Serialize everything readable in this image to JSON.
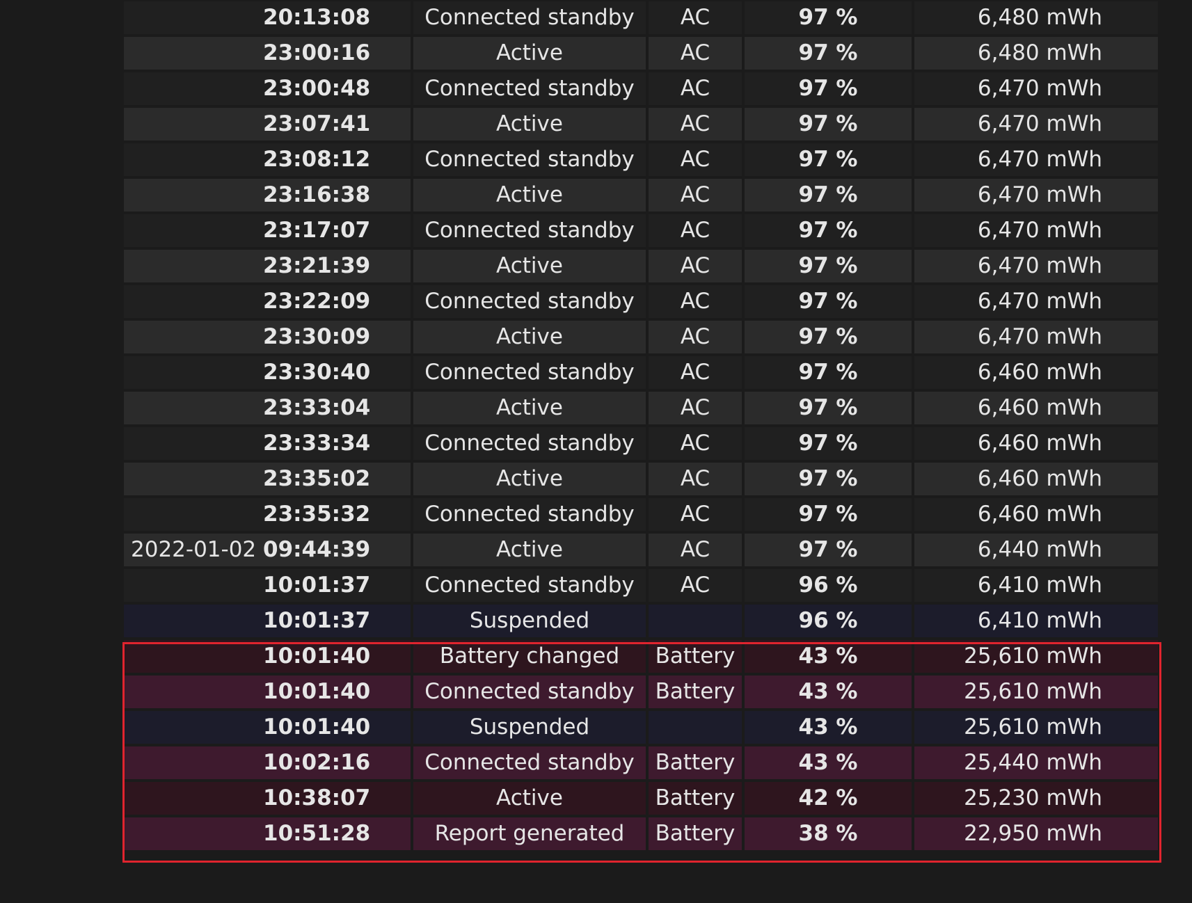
{
  "table": {
    "rows": [
      {
        "date": "",
        "time": "20:13:08",
        "state": "Connected standby",
        "source": "AC",
        "percent": "97 %",
        "capacity": "6,480 mWh",
        "style": "row-odd"
      },
      {
        "date": "",
        "time": "23:00:16",
        "state": "Active",
        "source": "AC",
        "percent": "97 %",
        "capacity": "6,480 mWh",
        "style": "row-even"
      },
      {
        "date": "",
        "time": "23:00:48",
        "state": "Connected standby",
        "source": "AC",
        "percent": "97 %",
        "capacity": "6,470 mWh",
        "style": "row-odd"
      },
      {
        "date": "",
        "time": "23:07:41",
        "state": "Active",
        "source": "AC",
        "percent": "97 %",
        "capacity": "6,470 mWh",
        "style": "row-even"
      },
      {
        "date": "",
        "time": "23:08:12",
        "state": "Connected standby",
        "source": "AC",
        "percent": "97 %",
        "capacity": "6,470 mWh",
        "style": "row-odd"
      },
      {
        "date": "",
        "time": "23:16:38",
        "state": "Active",
        "source": "AC",
        "percent": "97 %",
        "capacity": "6,470 mWh",
        "style": "row-even"
      },
      {
        "date": "",
        "time": "23:17:07",
        "state": "Connected standby",
        "source": "AC",
        "percent": "97 %",
        "capacity": "6,470 mWh",
        "style": "row-odd"
      },
      {
        "date": "",
        "time": "23:21:39",
        "state": "Active",
        "source": "AC",
        "percent": "97 %",
        "capacity": "6,470 mWh",
        "style": "row-even"
      },
      {
        "date": "",
        "time": "23:22:09",
        "state": "Connected standby",
        "source": "AC",
        "percent": "97 %",
        "capacity": "6,470 mWh",
        "style": "row-odd"
      },
      {
        "date": "",
        "time": "23:30:09",
        "state": "Active",
        "source": "AC",
        "percent": "97 %",
        "capacity": "6,470 mWh",
        "style": "row-even"
      },
      {
        "date": "",
        "time": "23:30:40",
        "state": "Connected standby",
        "source": "AC",
        "percent": "97 %",
        "capacity": "6,460 mWh",
        "style": "row-odd"
      },
      {
        "date": "",
        "time": "23:33:04",
        "state": "Active",
        "source": "AC",
        "percent": "97 %",
        "capacity": "6,460 mWh",
        "style": "row-even"
      },
      {
        "date": "",
        "time": "23:33:34",
        "state": "Connected standby",
        "source": "AC",
        "percent": "97 %",
        "capacity": "6,460 mWh",
        "style": "row-odd"
      },
      {
        "date": "",
        "time": "23:35:02",
        "state": "Active",
        "source": "AC",
        "percent": "97 %",
        "capacity": "6,460 mWh",
        "style": "row-even"
      },
      {
        "date": "",
        "time": "23:35:32",
        "state": "Connected standby",
        "source": "AC",
        "percent": "97 %",
        "capacity": "6,460 mWh",
        "style": "row-odd"
      },
      {
        "date": "2022-01-02",
        "time": "09:44:39",
        "state": "Active",
        "source": "AC",
        "percent": "97 %",
        "capacity": "6,440 mWh",
        "style": "row-even"
      },
      {
        "date": "",
        "time": "10:01:37",
        "state": "Connected standby",
        "source": "AC",
        "percent": "96 %",
        "capacity": "6,410 mWh",
        "style": "row-odd"
      },
      {
        "date": "",
        "time": "10:01:37",
        "state": "Suspended",
        "source": "",
        "percent": "96 %",
        "capacity": "6,410 mWh",
        "style": "row-suspended"
      },
      {
        "date": "",
        "time": "10:01:40",
        "state": "Battery changed",
        "source": "Battery",
        "percent": "43 %",
        "capacity": "25,610 mWh",
        "style": "row-battery-odd"
      },
      {
        "date": "",
        "time": "10:01:40",
        "state": "Connected standby",
        "source": "Battery",
        "percent": "43 %",
        "capacity": "25,610 mWh",
        "style": "row-battery-even"
      },
      {
        "date": "",
        "time": "10:01:40",
        "state": "Suspended",
        "source": "",
        "percent": "43 %",
        "capacity": "25,610 mWh",
        "style": "row-suspended"
      },
      {
        "date": "",
        "time": "10:02:16",
        "state": "Connected standby",
        "source": "Battery",
        "percent": "43 %",
        "capacity": "25,440 mWh",
        "style": "row-battery-even"
      },
      {
        "date": "",
        "time": "10:38:07",
        "state": "Active",
        "source": "Battery",
        "percent": "42 %",
        "capacity": "25,230 mWh",
        "style": "row-battery-odd"
      },
      {
        "date": "",
        "time": "10:51:28",
        "state": "Report generated",
        "source": "Battery",
        "percent": "38 %",
        "capacity": "22,950 mWh",
        "style": "row-battery-even"
      }
    ]
  },
  "colors": {
    "page_background": "#1b1b1b",
    "row_odd": "#202020",
    "row_even": "#2b2b2b",
    "row_suspended": "#1c1c2b",
    "row_battery_odd": "#2e151e",
    "row_battery_even": "#3e1a2e",
    "highlight_border": "#e0242e",
    "text": "#e6e6e6"
  }
}
